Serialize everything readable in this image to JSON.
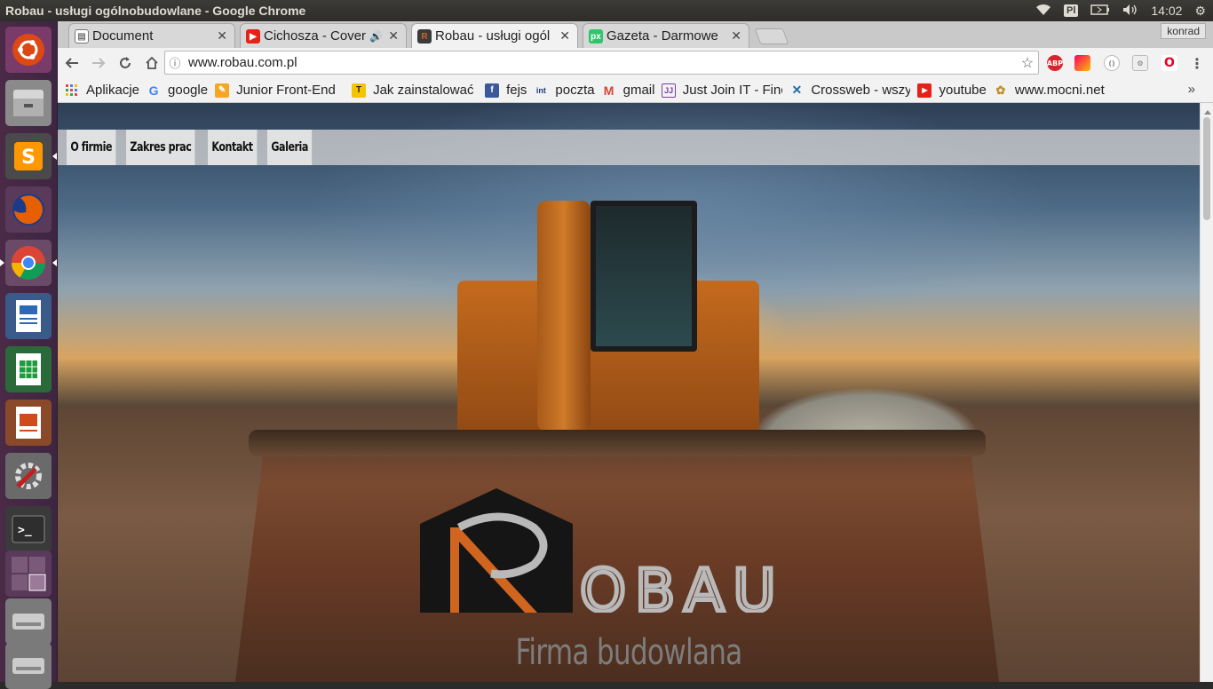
{
  "os": {
    "window_title": "Robau - usługi ogólnobudowlane - Google Chrome",
    "keyboard_layout": "Pl",
    "clock": "14:02",
    "launcher": [
      {
        "name": "ubuntu-dash",
        "color": "#dd4814"
      },
      {
        "name": "files",
        "color": "#8a8a8a"
      },
      {
        "name": "sublime-text",
        "color": "#ff9800"
      },
      {
        "name": "firefox",
        "color": "#e66000"
      },
      {
        "name": "chrome",
        "color": "#4285f4"
      },
      {
        "name": "libreoffice-writer",
        "color": "#2a6ab8"
      },
      {
        "name": "libreoffice-calc",
        "color": "#1f9a3c"
      },
      {
        "name": "libreoffice-impress",
        "color": "#d04a1a"
      },
      {
        "name": "system-settings",
        "color": "#b02020"
      },
      {
        "name": "terminal",
        "color": "#2e2e2e"
      },
      {
        "name": "workspace-switcher",
        "color": "#6a3a66"
      },
      {
        "name": "drive-1",
        "color": "#9a9a9a"
      },
      {
        "name": "drive-2",
        "color": "#9a9a9a"
      }
    ]
  },
  "browser": {
    "tabs": [
      {
        "label": "Document",
        "icon": "document-icon",
        "color": "#6a6a6a"
      },
      {
        "label": "Cichosza - Cover",
        "icon": "youtube-icon",
        "color": "#e62117",
        "audio": true
      },
      {
        "label": "Robau - usługi ogól",
        "icon": "robau-icon",
        "color": "#3a3a3a",
        "active": true
      },
      {
        "label": "Gazeta - Darmowe",
        "icon": "pixabay-icon",
        "color": "#2ec66d"
      }
    ],
    "profile": "konrad",
    "url": "www.robau.com.pl",
    "bookmarks": [
      {
        "label": "Aplikacje",
        "icon": "apps-grid-icon",
        "color": "#e44"
      },
      {
        "label": "google",
        "icon": "google-icon",
        "color": "#4285f4"
      },
      {
        "label": "Junior Front-End",
        "icon": "pencil-icon",
        "color": "#f5a623"
      },
      {
        "label": "Jak zainstalować",
        "icon": "t-icon",
        "color": "#f5c400"
      },
      {
        "label": "fejs",
        "icon": "facebook-icon",
        "color": "#3b5998"
      },
      {
        "label": "poczta",
        "icon": "int-icon",
        "color": "#1a3d7c"
      },
      {
        "label": "gmail",
        "icon": "gmail-icon",
        "color": "#d44638"
      },
      {
        "label": "Just Join IT - Find",
        "icon": "justjoin-icon",
        "color": "#7b3fa0"
      },
      {
        "label": "Crossweb - wszy",
        "icon": "crossweb-icon",
        "color": "#1f6fa8"
      },
      {
        "label": "youtube",
        "icon": "youtube-icon",
        "color": "#e62117"
      },
      {
        "label": "www.mocni.net",
        "icon": "mocni-icon",
        "color": "#c0902a"
      }
    ],
    "more": "»"
  },
  "page": {
    "nav": [
      "O firmie",
      "Zakres prac",
      "Kontakt",
      "Galeria"
    ],
    "logo_text": "OBAU",
    "tagline": "Firma budowlana",
    "colors": {
      "logo_orange": "#d0651f",
      "logo_gray": "#b9b9b9",
      "logo_dark": "#151515"
    }
  }
}
